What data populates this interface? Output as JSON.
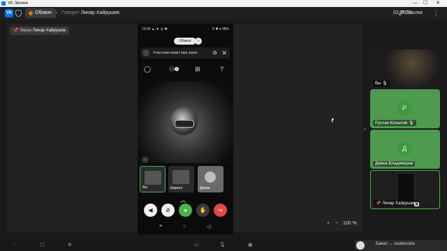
{
  "window": {
    "title": "VK Звонки",
    "controls": [
      "—",
      "☐",
      "✕"
    ]
  },
  "topbar": {
    "logo": "VK",
    "call_label": "Обзвон",
    "speaker_label": "Говорит",
    "speaker_name": "Линар Хайрушев",
    "timer": "02:55:58",
    "link_label": "Ссылка"
  },
  "stage": {
    "screen_prefix": "Экран",
    "screen_owner": "Линар Хайрушев",
    "zoom_minus": "−",
    "zoom_plus": "+",
    "zoom_value": "100 %"
  },
  "phone": {
    "status_time": "19:04",
    "status_icons": "▲ ▼ ◎ ✱",
    "status_right": "⚲ ✱ ▾ 38%",
    "call_pill": "Обзвон",
    "banner_text": "Участники видят ваш экран",
    "participants_badge": "3",
    "thumbs": [
      {
        "name": "Вы"
      },
      {
        "name": "Кирилл"
      },
      {
        "name": "Димка"
      }
    ],
    "nav": [
      "≡",
      "○",
      "◁"
    ]
  },
  "participants": [
    {
      "name": "Вы",
      "initial": ""
    },
    {
      "name": "Руслан Копылов",
      "initial": "Р"
    },
    {
      "name": "Димка Владимиров",
      "initial": "Д"
    },
    {
      "name": "Линар Хайрушев",
      "initial": ""
    }
  ],
  "toast": {
    "text": "Бакал → ouukirusha"
  },
  "colors": {
    "accent": "#0077ff",
    "green": "#4bb34b",
    "red": "#e64646",
    "orange": "#ff6a00"
  }
}
